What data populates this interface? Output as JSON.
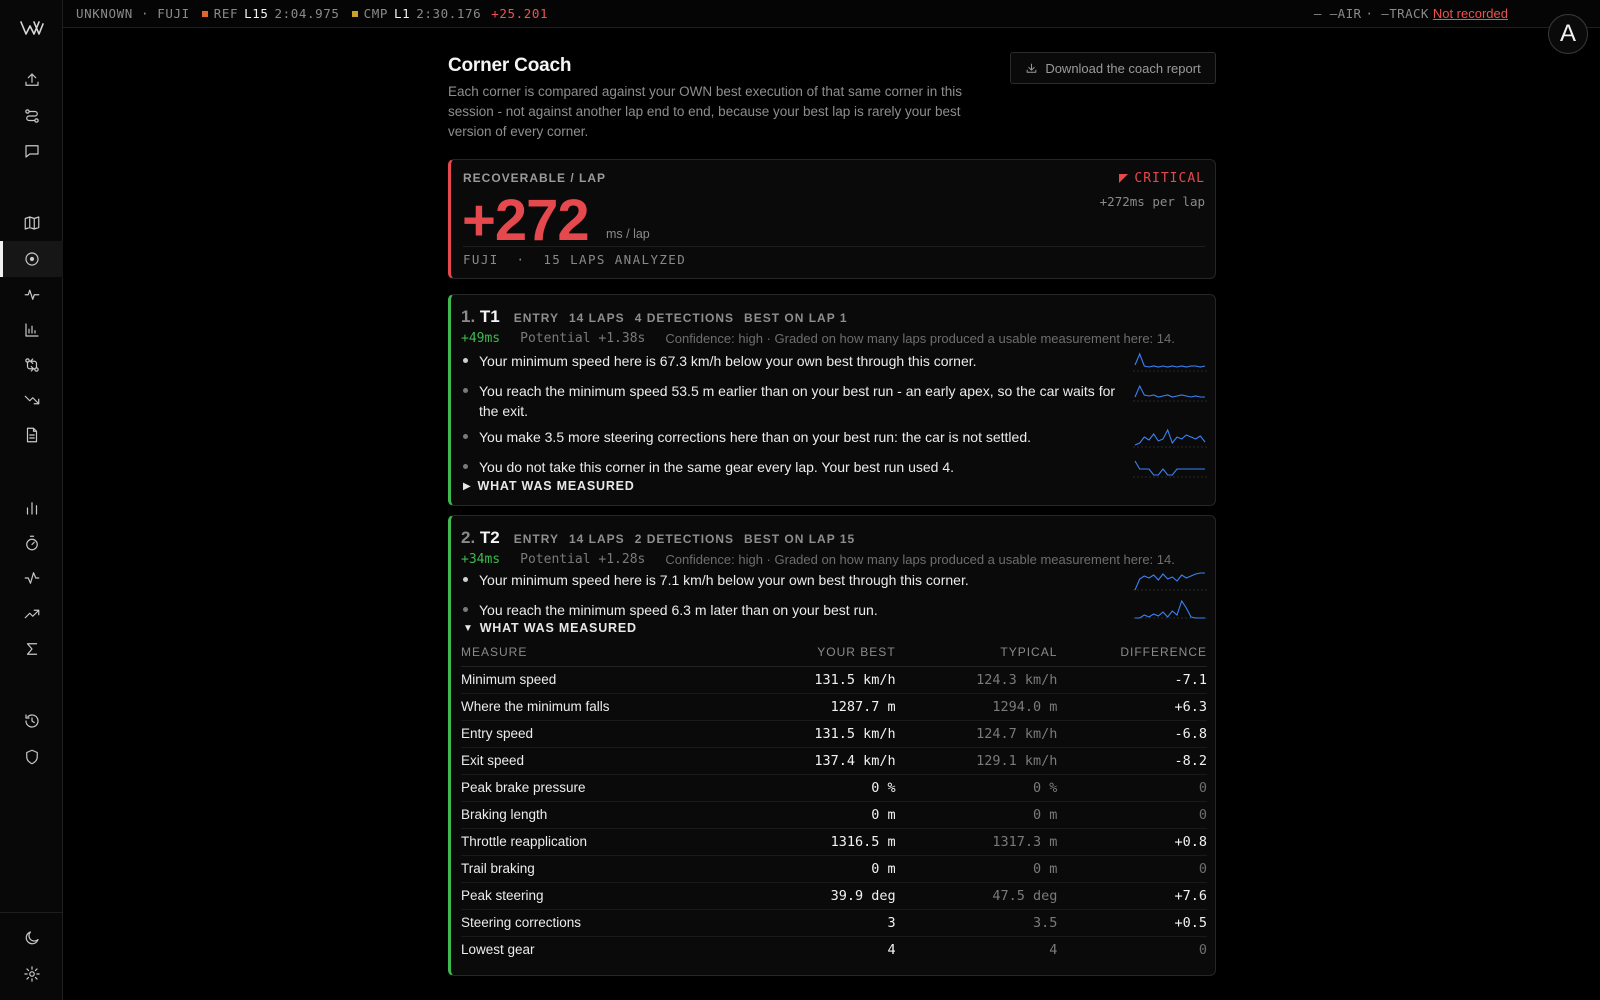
{
  "topbar": {
    "session": "UNKNOWN · FUJI",
    "ref_label": "REF",
    "ref_lap": "L15",
    "ref_time": "2:04.975",
    "ref_color": "#e0662a",
    "cmp_label": "CMP",
    "cmp_lap": "L1",
    "cmp_time": "2:30.176",
    "cmp_color": "#c9a227",
    "delta": "+25.201",
    "air_label": "— —AIR",
    "track_label": "· —TRACK",
    "not_recorded": "Not recorded"
  },
  "avatar": {
    "initial": "A"
  },
  "sidebar": {
    "items": [
      {
        "icon": "upload-icon"
      },
      {
        "icon": "route-icon"
      },
      {
        "icon": "chat-icon"
      },
      {
        "icon": "map-icon"
      },
      {
        "icon": "target-icon",
        "active": true
      },
      {
        "icon": "pulse-icon"
      },
      {
        "icon": "bar-chart-icon"
      },
      {
        "icon": "compare-icon"
      },
      {
        "icon": "trend-down-icon"
      },
      {
        "icon": "document-icon"
      },
      {
        "icon": "column-chart-icon"
      },
      {
        "icon": "stopwatch-icon"
      },
      {
        "icon": "activity-icon"
      },
      {
        "icon": "trend-up-icon"
      },
      {
        "icon": "sigma-icon"
      },
      {
        "icon": "history-icon"
      },
      {
        "icon": "shield-icon"
      },
      {
        "icon": "moon-icon"
      },
      {
        "icon": "gear-icon"
      }
    ]
  },
  "page": {
    "title": "Corner Coach",
    "description": "Each corner is compared against your OWN best execution of that same corner in this session - not against another lap end to end, because your best lap is rarely your best version of every corner.",
    "download_label": "Download the coach report"
  },
  "summary": {
    "label": "RECOVERABLE / LAP",
    "value": "+272",
    "unit": "ms / lap",
    "level": "CRITICAL",
    "level_color": "#e5484d",
    "per_lap": "+272ms per lap",
    "footer": "FUJI  ·  15 LAPS ANALYZED"
  },
  "corners": [
    {
      "index": "1.",
      "name": "T1",
      "phase": "ENTRY",
      "laps": "14 LAPS",
      "detections": "4 DETECTIONS",
      "best_on": "BEST ON LAP 1",
      "delta": "+49ms",
      "potential": "Potential +1.38s",
      "confidence": "Confidence: high · Graded on how many laps produced a usable measurement here: 14.",
      "findings": [
        {
          "text": "Your minimum speed here is 67.3 km/h below your own best through this corner.",
          "spark": [
            14,
            3,
            15,
            16,
            15,
            16,
            15,
            16,
            15,
            16,
            15,
            16,
            15,
            15,
            16,
            15
          ]
        },
        {
          "text": "You reach the minimum speed 53.5 m earlier than on your best run - an early apex, so the car waits for the exit.",
          "spark": [
            16,
            5,
            14,
            15,
            14,
            16,
            15,
            14,
            16,
            15,
            14,
            15,
            16,
            15,
            16,
            16
          ]
        },
        {
          "text": "You make 3.5 more steering corrections here than on your best run: the car is not settled.",
          "spark": [
            18,
            16,
            10,
            13,
            7,
            14,
            12,
            3,
            16,
            10,
            12,
            8,
            10,
            12,
            9,
            15
          ]
        },
        {
          "text": "You do not take this corner in the same gear every lap. Your best run used 4.",
          "spark": [
            4,
            12,
            12,
            12,
            18,
            18,
            12,
            18,
            18,
            12,
            12,
            12,
            12,
            12,
            12,
            12
          ]
        }
      ],
      "measured_label": "WHAT WAS MEASURED",
      "expanded": false
    },
    {
      "index": "2.",
      "name": "T2",
      "phase": "ENTRY",
      "laps": "14 LAPS",
      "detections": "2 DETECTIONS",
      "best_on": "BEST ON LAP 15",
      "delta": "+34ms",
      "potential": "Potential +1.28s",
      "confidence": "Confidence: high · Graded on how many laps produced a usable measurement here: 14.",
      "findings": [
        {
          "text": "Your minimum speed here is 7.1 km/h below your own best through this corner.",
          "spark": [
            20,
            9,
            6,
            8,
            5,
            10,
            4,
            9,
            7,
            11,
            5,
            8,
            6,
            4,
            3,
            3
          ]
        },
        {
          "text": "You reach the minimum speed 6.3 m later than on your best run.",
          "spark": [
            20,
            20,
            17,
            19,
            16,
            18,
            14,
            19,
            13,
            17,
            3,
            10,
            19,
            20,
            20,
            20
          ]
        }
      ],
      "measured_label": "WHAT WAS MEASURED",
      "expanded": true,
      "table": {
        "headers": [
          "MEASURE",
          "YOUR BEST",
          "TYPICAL",
          "DIFFERENCE"
        ],
        "rows": [
          [
            "Minimum speed",
            "131.5 km/h",
            "124.3 km/h",
            "-7.1"
          ],
          [
            "Where the minimum falls",
            "1287.7 m",
            "1294.0 m",
            "+6.3"
          ],
          [
            "Entry speed",
            "131.5 km/h",
            "124.7 km/h",
            "-6.8"
          ],
          [
            "Exit speed",
            "137.4 km/h",
            "129.1 km/h",
            "-8.2"
          ],
          [
            "Peak brake pressure",
            "0 %",
            "0 %",
            "0"
          ],
          [
            "Braking length",
            "0 m",
            "0 m",
            "0"
          ],
          [
            "Throttle reapplication",
            "1316.5 m",
            "1317.3 m",
            "+0.8"
          ],
          [
            "Trail braking",
            "0 m",
            "0 m",
            "0"
          ],
          [
            "Peak steering",
            "39.9 deg",
            "47.5 deg",
            "+7.6"
          ],
          [
            "Steering corrections",
            "3",
            "3.5",
            "+0.5"
          ],
          [
            "Lowest gear",
            "4",
            "4",
            "0"
          ]
        ]
      }
    }
  ],
  "colors": {
    "accent_red": "#e5484d",
    "accent_green": "#3fb950",
    "spark_blue": "#3b82f6"
  }
}
